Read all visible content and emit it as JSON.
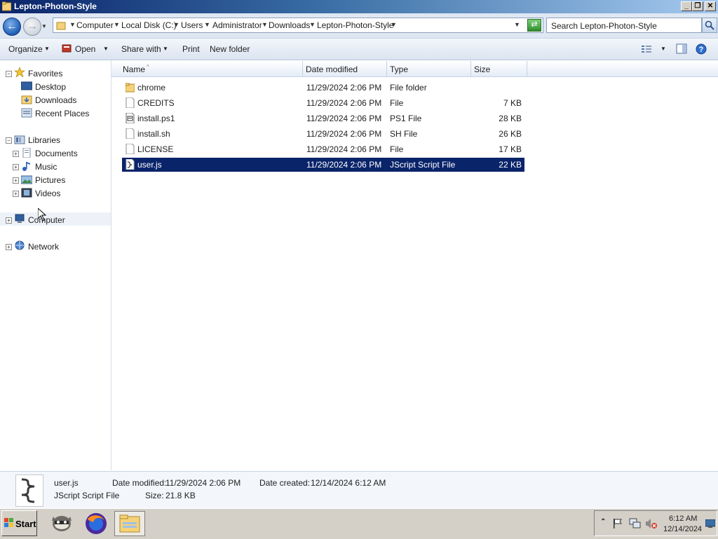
{
  "window": {
    "title": "Lepton-Photon-Style"
  },
  "caption_buttons": {
    "minimize": "_",
    "restore": "❐",
    "close": "✕"
  },
  "address": {
    "crumbs": [
      "Computer",
      "Local Disk (C:)",
      "Users",
      "Administrator",
      "Downloads",
      "Lepton-Photon-Style"
    ]
  },
  "search": {
    "placeholder": "Search Lepton-Photon-Style"
  },
  "toolbar": {
    "organize": "Organize",
    "open": "Open",
    "share_with": "Share with",
    "print": "Print",
    "new_folder": "New folder"
  },
  "nav": {
    "favorites": "Favorites",
    "desktop": "Desktop",
    "downloads": "Downloads",
    "recent_places": "Recent Places",
    "libraries": "Libraries",
    "documents": "Documents",
    "music": "Music",
    "pictures": "Pictures",
    "videos": "Videos",
    "computer": "Computer",
    "network": "Network"
  },
  "columns": {
    "name": "Name",
    "date_modified": "Date modified",
    "type": "Type",
    "size": "Size"
  },
  "files": [
    {
      "name": "chrome",
      "date": "11/29/2024 2:06 PM",
      "type": "File folder",
      "size": "",
      "icon": "folder-icon"
    },
    {
      "name": "CREDITS",
      "date": "11/29/2024 2:06 PM",
      "type": "File",
      "size": "7 KB",
      "icon": "file-icon"
    },
    {
      "name": "install.ps1",
      "date": "11/29/2024 2:06 PM",
      "type": "PS1 File",
      "size": "28 KB",
      "icon": "script-file-icon"
    },
    {
      "name": "install.sh",
      "date": "11/29/2024 2:06 PM",
      "type": "SH File",
      "size": "26 KB",
      "icon": "file-icon"
    },
    {
      "name": "LICENSE",
      "date": "11/29/2024 2:06 PM",
      "type": "File",
      "size": "17 KB",
      "icon": "file-icon"
    },
    {
      "name": "user.js",
      "date": "11/29/2024 2:06 PM",
      "type": "JScript Script File",
      "size": "22 KB",
      "icon": "jscript-file-icon",
      "selected": true
    }
  ],
  "details": {
    "name": "user.js",
    "type": "JScript Script File",
    "date_modified_label": "Date modified:",
    "date_modified": "11/29/2024 2:06 PM",
    "date_created_label": "Date created:",
    "date_created": "12/14/2024 6:12 AM",
    "size_label": "Size:",
    "size": "21.8 KB"
  },
  "taskbar": {
    "start": "Start",
    "clock_time": "6:12 AM",
    "clock_date": "12/14/2024"
  },
  "colors": {
    "selection": "#0a246a",
    "accent": "#1f5fb7"
  }
}
